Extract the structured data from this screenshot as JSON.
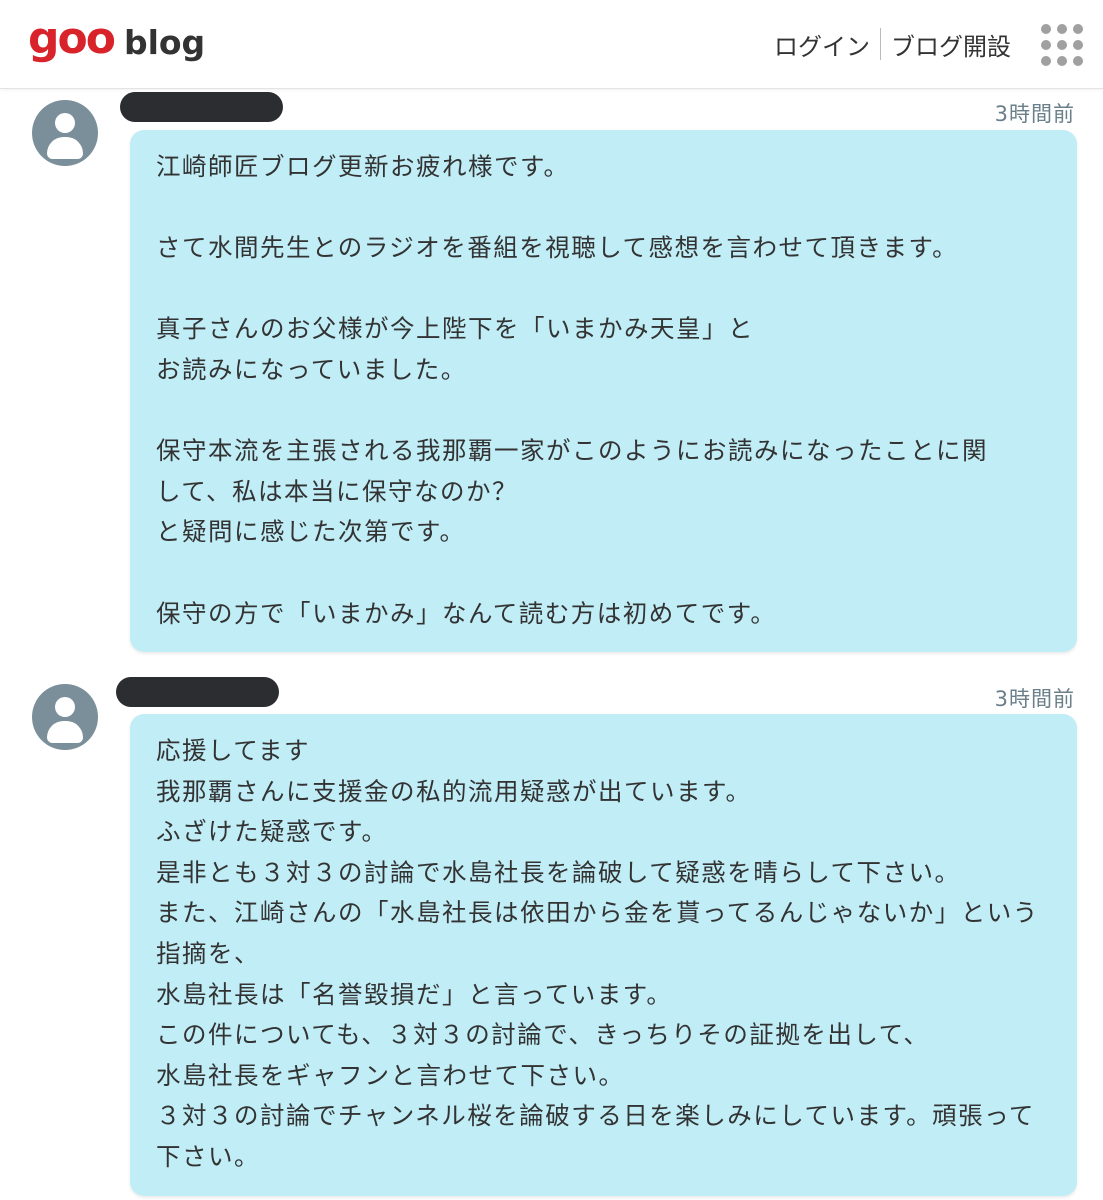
{
  "header": {
    "logo_main": "goo",
    "logo_sub": "blog",
    "login_label": "ログイン",
    "create_blog_label": "ブログ開設",
    "menu_icon": "grid-menu-icon"
  },
  "comments": [
    {
      "author": "",
      "author_redacted": true,
      "time": "3時間前",
      "avatar_icon": "user-avatar-icon",
      "lines": [
        "江崎師匠ブログ更新お疲れ様です。",
        "",
        "さて水間先生とのラジオを番組を視聴して感想を言わせて頂きます。",
        "",
        "真子さんのお父様が今上陛下を「いまかみ天皇」と",
        "お読みになっていました。",
        "",
        "保守本流を主張される我那覇一家がこのようにお読みになったことに関",
        "して、私は本当に保守なのか？",
        "と疑問に感じた次第です。",
        "",
        "保守の方で「いまかみ」なんて読む方は初めてです。"
      ]
    },
    {
      "author": "",
      "author_redacted": true,
      "time": "3時間前",
      "avatar_icon": "user-avatar-icon",
      "lines": [
        "応援してます",
        "我那覇さんに支援金の私的流用疑惑が出ています。",
        "ふざけた疑惑です。",
        "是非とも３対３の討論で水島社長を論破して疑惑を晴らして下さい。",
        "また、江崎さんの「水島社長は依田から金を貰ってるんじゃないか」という",
        "指摘を、",
        "水島社長は「名誉毀損だ」と言っています。",
        "この件についても、３対３の討論で、きっちりその証拠を出して、",
        "水島社長をギャフンと言わせて下さい。",
        "３対３の討論でチャンネル桜を論破する日を楽しみにしています。頑張って",
        "下さい。"
      ]
    }
  ],
  "colors": {
    "bubble": "#c0edf6",
    "logo_red": "#d8232a",
    "avatar": "#7a8f9a"
  }
}
